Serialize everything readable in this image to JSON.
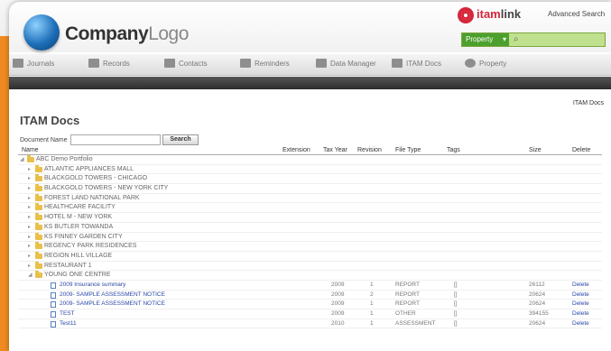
{
  "header": {
    "logo_main": "Company",
    "logo_light": "Logo",
    "brand_accent": "itam",
    "brand_rest": "link",
    "advanced_search": "Advanced Search",
    "search_scope": "Property",
    "search_placeholder": ""
  },
  "nav": {
    "items": [
      {
        "label": "Journals"
      },
      {
        "label": "Records"
      },
      {
        "label": "Contacts"
      },
      {
        "label": "Reminders"
      },
      {
        "label": "Data Manager"
      },
      {
        "label": "ITAM Docs"
      },
      {
        "label": "Property"
      }
    ]
  },
  "page": {
    "breadcrumb": "ITAM Docs",
    "title": "ITAM Docs",
    "doc_name_label": "Document Name",
    "search_button": "Search"
  },
  "table": {
    "headers": [
      "Name",
      "Extension",
      "Tax Year",
      "Revision",
      "File Type",
      "Tags",
      "Size",
      "Delete"
    ],
    "root": "ABC Demo Portfolio",
    "folders": [
      "ATLANTIC APPLIANCES MALL",
      "BLACKGOLD TOWERS - CHICAGO",
      "BLACKGOLD TOWERS - NEW YORK CITY",
      "FOREST LAND NATIONAL PARK",
      "HEALTHCARE FACILITY",
      "HOTEL M - NEW YORK",
      "KS BUTLER TOWANDA",
      "KS FINNEY GARDEN CITY",
      "REGENCY PARK RESIDENCES",
      "REGION HILL VILLAGE",
      "RESTAURANT 1"
    ],
    "open_folder": "YOUNG ONE CENTRE",
    "docs": [
      {
        "name": "2009 Insurance summary",
        "year": "2009",
        "rev": "1",
        "type": "REPORT",
        "tags": "[]",
        "size": "26112",
        "del": "Delete"
      },
      {
        "name": "2009- SAMPLE ASSESSMENT NOTICE",
        "year": "2009",
        "rev": "2",
        "type": "REPORT",
        "tags": "[]",
        "size": "20624",
        "del": "Delete"
      },
      {
        "name": "2009- SAMPLE ASSESSMENT NOTICE",
        "year": "2009",
        "rev": "1",
        "type": "REPORT",
        "tags": "[]",
        "size": "20624",
        "del": "Delete"
      },
      {
        "name": "TEST",
        "year": "2009",
        "rev": "1",
        "type": "OTHER",
        "tags": "[]",
        "size": "394155",
        "del": "Delete"
      },
      {
        "name": "Test11",
        "year": "2010",
        "rev": "1",
        "type": "ASSESSMENT",
        "tags": "[]",
        "size": "20624",
        "del": "Delete"
      }
    ]
  }
}
